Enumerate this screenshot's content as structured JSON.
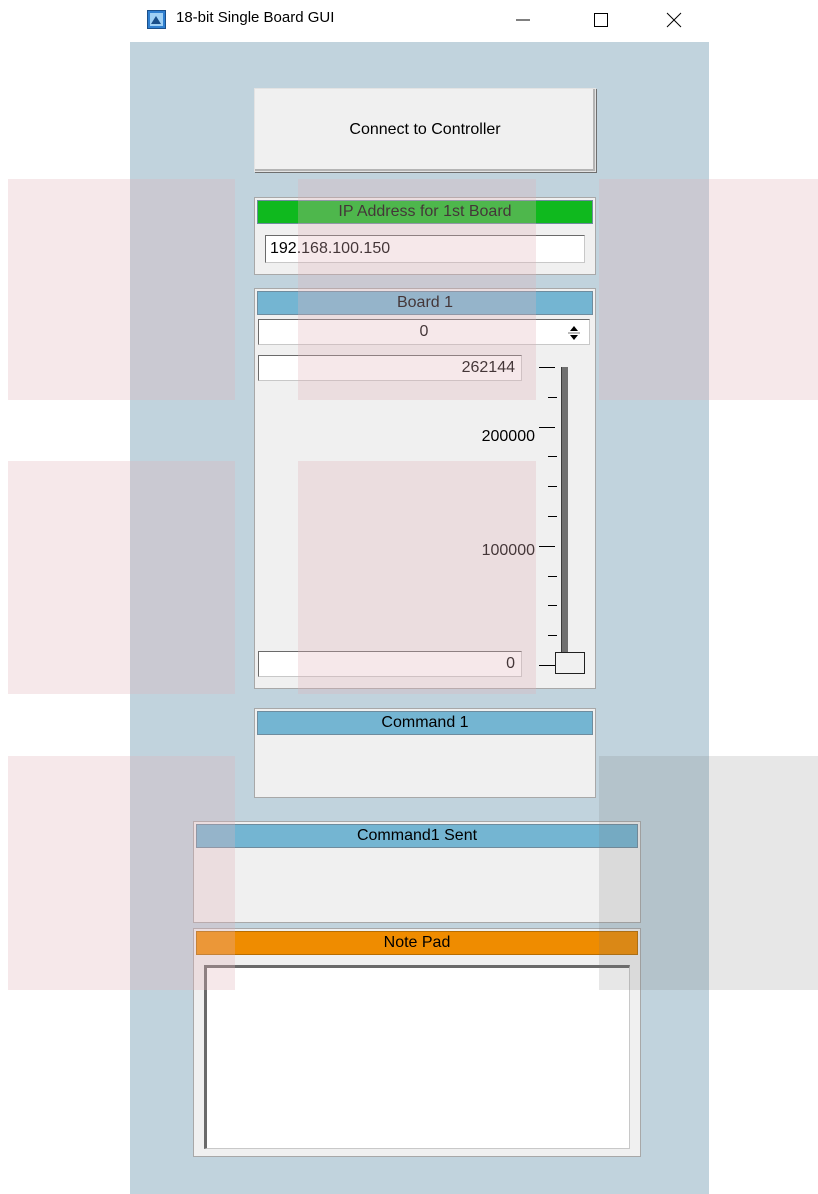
{
  "window": {
    "title": "18-bit Single Board GUI",
    "minimize_glyph": "—",
    "maximize_glyph": "☐",
    "close_glyph": "✕",
    "app_icon": "app-icon"
  },
  "connect_button": {
    "label": "Connect to Controller"
  },
  "ip_panel": {
    "header": "IP Address for 1st Board",
    "value": "192.168.100.150"
  },
  "board_panel": {
    "header": "Board 1",
    "numeric_value": "0",
    "max_value": "262144",
    "min_value": "0",
    "slider": {
      "value": 0,
      "range": [
        0,
        262144
      ],
      "tick_labels": [
        "200000",
        "100000"
      ]
    }
  },
  "command_panel": {
    "header": "Command 1"
  },
  "command_sent_panel": {
    "header": "Command1 Sent"
  },
  "note_pad": {
    "header": "Note Pad",
    "content": ""
  },
  "colors": {
    "background": "#c1d3dd",
    "header_green": "#0fb91e",
    "header_blue": "#74b5d2",
    "header_orange": "#ef8c00"
  }
}
